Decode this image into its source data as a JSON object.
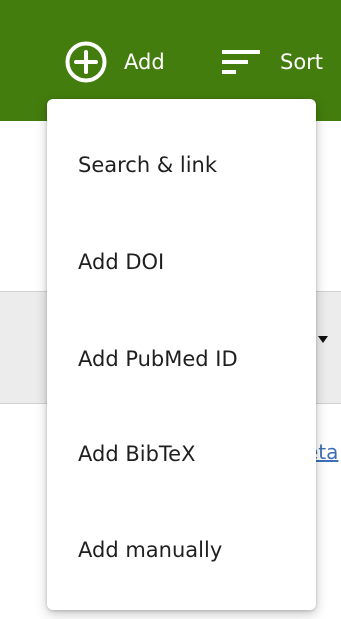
{
  "toolbar": {
    "add_label": "Add",
    "sort_label": "Sort",
    "add_icon": "plus-circle-icon",
    "sort_icon": "sort-icon",
    "background_color": "#437d0e"
  },
  "behind": {
    "partial_link_text": "eta"
  },
  "menu": {
    "items": [
      {
        "label": "Search & link"
      },
      {
        "label": "Add DOI"
      },
      {
        "label": "Add PubMed ID"
      },
      {
        "label": "Add BibTeX"
      },
      {
        "label": "Add manually"
      }
    ]
  }
}
